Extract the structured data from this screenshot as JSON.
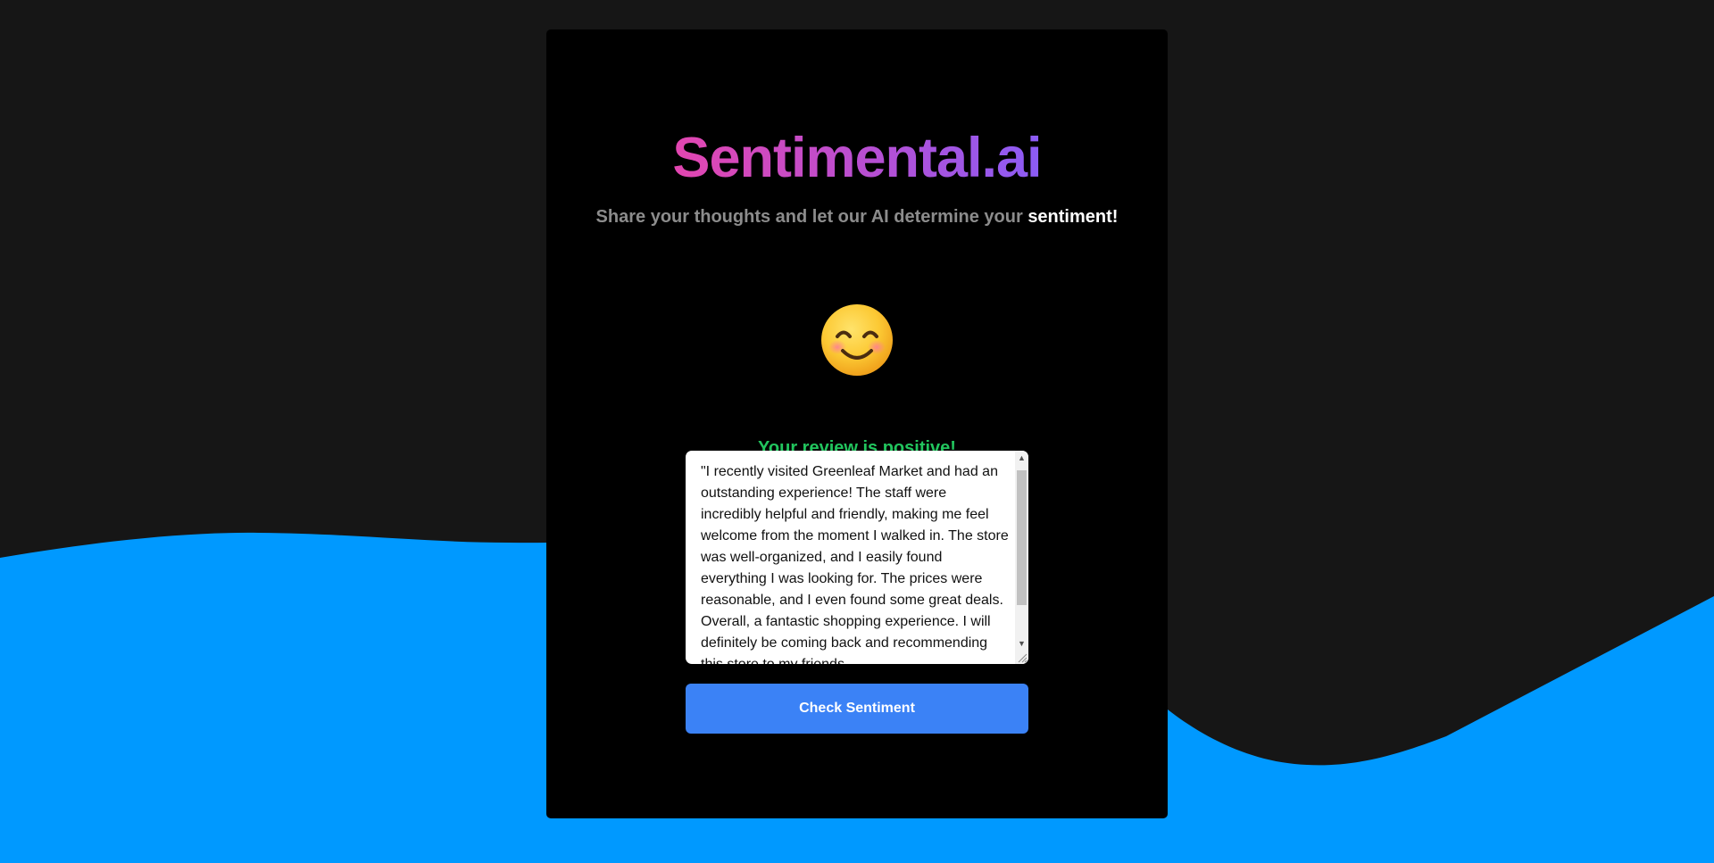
{
  "app": {
    "title": "Sentimental.ai"
  },
  "subtitle": {
    "lead": "Share your thoughts and let our AI determine your ",
    "emphasis": "sentiment!"
  },
  "result": {
    "icon": "smiling-face-icon",
    "text": "Your review is positive!",
    "color": "#22c55e"
  },
  "review": {
    "value": "\"I recently visited Greenleaf Market and had an outstanding experience! The staff were incredibly helpful and friendly, making me feel welcome from the moment I walked in. The store was well-organized, and I easily found everything I was looking for. The prices were reasonable, and I even found some great deals. Overall, a fantastic shopping experience. I will definitely be coming back and recommending this store to my friends."
  },
  "actions": {
    "check_label": "Check Sentiment"
  },
  "colors": {
    "page_background": "#161616",
    "wave": "#0099ff",
    "card": "#000000",
    "button": "#3b82f6",
    "title_gradient_start": "#e346b0",
    "title_gradient_end": "#8b5cf6"
  }
}
